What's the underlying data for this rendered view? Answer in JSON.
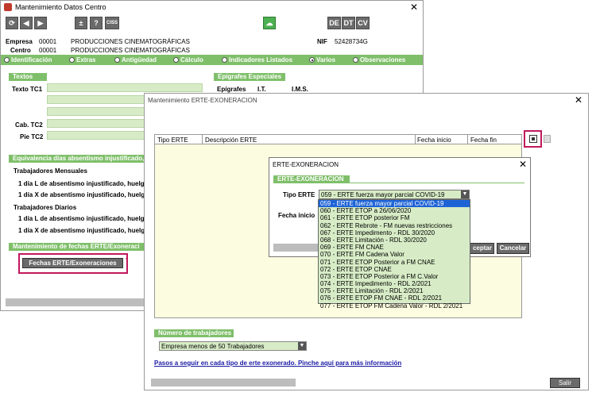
{
  "main": {
    "title": "Mantenimiento Datos Centro",
    "toolbar": {
      "plusminus": "±",
      "help": "?",
      "ciss": "CISS",
      "de": "DE",
      "dt": "DT",
      "cv": "CV"
    },
    "empresa_label": "Empresa",
    "empresa_code": "00001",
    "empresa_name": "PRODUCCIONES CINEMATOGRÁFICAS",
    "centro_label": "Centro",
    "centro_code": "00001",
    "centro_name": "PRODUCCIONES CINEMATOGRÁFICAS",
    "nif_label": "NIF",
    "nif_value": "52428734G",
    "tabs": [
      "Identificación",
      "Extras",
      "Antigüedad",
      "Cálculo",
      "Indicadores Listados",
      "Varios",
      "Observaciones"
    ],
    "textos_header": "Textos",
    "texto_tc1": "Texto TC1",
    "cab_tc2": "Cab. TC2",
    "pie_tc2": "Pie TC2",
    "epigrafes_header": "Epígrafes Especiales",
    "epigrafes": "Epígrafes",
    "it": "I.T.",
    "ims": "I.M.S.",
    "equiv_header": "Equivalencia días absentismo injustificado,",
    "trab_mensuales": "Trabajadores Mensuales",
    "line1": "1 día L de absentismo injustificado, huelg",
    "line2": "1 día X de absentismo injustificado, huelg",
    "trab_diarios": "Trabajadores Diarios",
    "line3": "1 día L de absentismo injustificado, huelg",
    "line4": "1 día X de absentismo injustificado, huelg",
    "mant_header": "Mantenimiento de fechas ERTE/Exoneraci",
    "fechas_button": "Fechas ERTE/Exoneraciones"
  },
  "erte": {
    "title": "Mantenimiento ERTE-EXONERACION",
    "columns": [
      "Tipo ERTE",
      "Descripción ERTE",
      "Fecha inicio",
      "Fecha fin"
    ],
    "num_trab_header": "Número de trabajadores",
    "num_trab_value": "Empresa menos de 50 Trabajadores",
    "link": "Pasos a seguir en cada tipo de erte exonerado. Pinche aquí para más información",
    "salir": "Salir"
  },
  "dialog": {
    "title": "ERTE-EXONERACION",
    "section": "ERTE-EXONERACION",
    "tipo_label": "Tipo ERTE",
    "tipo_value": "059 - ERTE fuerza mayor parcial COVID-19",
    "fecha_label": "Fecha inicio",
    "aceptar": "ceptar",
    "cancelar": "Cancelar",
    "options": [
      "059 - ERTE fuerza mayor parcial COVID-19",
      "060 - ERTE ETOP a 26/06/2020",
      "061 - ERTE ETOP posterior FM",
      "062 - ERTE Rebrote - FM nuevas restricciones",
      "067 - ERTE Impedimento - RDL 30/2020",
      "068 - ERTE Limitación - RDL 30/2020",
      "069 - ERTE FM CNAE",
      "070 - ERTE FM Cadena Valor",
      "071 - ERTE ETOP Posterior a FM CNAE",
      "072 - ERTE ETOP CNAE",
      "073 - ERTE ETOP Posterior a FM C.Valor",
      "074 - ERTE Impedimento - RDL 2/2021",
      "075 - ERTE Limitación - RDL 2/2021",
      "076 - ERTE ETOP FM CNAE - RDL 2/2021",
      "077 - ERTE ETOP FM Cadena Valor - RDL 2/2021"
    ]
  }
}
